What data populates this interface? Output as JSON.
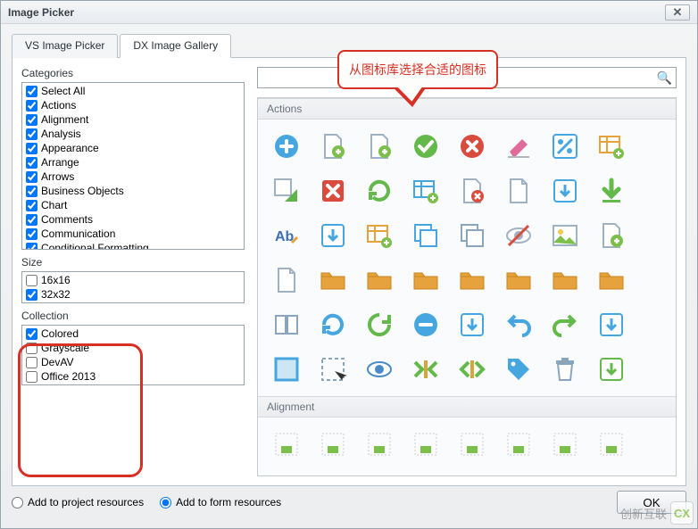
{
  "window": {
    "title": "Image Picker",
    "close_glyph": "✕"
  },
  "tabs": [
    {
      "id": "vs",
      "label": "VS Image Picker",
      "active": false
    },
    {
      "id": "dx",
      "label": "DX Image Gallery",
      "active": true
    }
  ],
  "callout": {
    "text": "从图标库选择合适的图标"
  },
  "categories": {
    "label": "Categories",
    "items": [
      {
        "label": "Select All",
        "checked": true
      },
      {
        "label": "Actions",
        "checked": true
      },
      {
        "label": "Alignment",
        "checked": true
      },
      {
        "label": "Analysis",
        "checked": true
      },
      {
        "label": "Appearance",
        "checked": true
      },
      {
        "label": "Arrange",
        "checked": true
      },
      {
        "label": "Arrows",
        "checked": true
      },
      {
        "label": "Business Objects",
        "checked": true
      },
      {
        "label": "Chart",
        "checked": true
      },
      {
        "label": "Comments",
        "checked": true
      },
      {
        "label": "Communication",
        "checked": true
      },
      {
        "label": "Conditional Formatting",
        "checked": true
      }
    ]
  },
  "size": {
    "label": "Size",
    "items": [
      {
        "label": "16x16",
        "checked": false
      },
      {
        "label": "32x32",
        "checked": true
      }
    ]
  },
  "collection": {
    "label": "Collection",
    "items": [
      {
        "label": "Colored",
        "checked": true
      },
      {
        "label": "Grayscale",
        "checked": false
      },
      {
        "label": "DevAV",
        "checked": false
      },
      {
        "label": "Office 2013",
        "checked": false
      }
    ]
  },
  "search": {
    "placeholder": ""
  },
  "sections": [
    {
      "title": "Actions",
      "icons": [
        {
          "name": "add-circle-icon",
          "c": "#46a7e0",
          "t": "plus-circle"
        },
        {
          "name": "add-page-icon",
          "c": "#7cc04b",
          "t": "page-plus"
        },
        {
          "name": "add-doc-icon",
          "c": "#7cc04b",
          "t": "doc-plus"
        },
        {
          "name": "apply-icon",
          "c": "#63b94a",
          "t": "check-circle"
        },
        {
          "name": "cancel-circle-icon",
          "c": "#d94b3d",
          "t": "x-circle"
        },
        {
          "name": "clear-icon",
          "c": "#e06a9a",
          "t": "eraser"
        },
        {
          "name": "percent-icon",
          "c": "#46a7e0",
          "t": "percent"
        },
        {
          "name": "table-add-icon",
          "c": "#e6a23c",
          "t": "table-plus"
        },
        {
          "name": "convert-icon",
          "c": "#60b24b",
          "t": "arrow-corner"
        },
        {
          "name": "close-box-icon",
          "c": "#d94b3d",
          "t": "x-box"
        },
        {
          "name": "refresh-green-icon",
          "c": "#63b94a",
          "t": "refresh"
        },
        {
          "name": "table-refresh-icon",
          "c": "#46a7e0",
          "t": "table-refresh"
        },
        {
          "name": "page-delete-icon",
          "c": "#d94b3d",
          "t": "page-x"
        },
        {
          "name": "page-icon",
          "c": "#8aa6bd",
          "t": "page"
        },
        {
          "name": "download-box-icon",
          "c": "#46a7e0",
          "t": "down-box"
        },
        {
          "name": "download-green-icon",
          "c": "#63b94a",
          "t": "down-arrow"
        },
        {
          "name": "spellcheck-icon",
          "c": "#3d6fb5",
          "t": "ab"
        },
        {
          "name": "down-box-icon",
          "c": "#46a7e0",
          "t": "down-square"
        },
        {
          "name": "table-edit-icon",
          "c": "#e6a23c",
          "t": "table-pen"
        },
        {
          "name": "copy-icon",
          "c": "#46a7e0",
          "t": "copy"
        },
        {
          "name": "duplicate-icon",
          "c": "#8aa6bd",
          "t": "dup"
        },
        {
          "name": "hide-icon",
          "c": "#d94b3d",
          "t": "eye-slash"
        },
        {
          "name": "picture-icon",
          "c": "#e6a23c",
          "t": "picture"
        },
        {
          "name": "page-add-icon",
          "c": "#7cc04b",
          "t": "page-plus2"
        },
        {
          "name": "new-doc-icon",
          "c": "#8aa6bd",
          "t": "new"
        },
        {
          "name": "folder-icon",
          "c": "#e6a23c",
          "t": "folder"
        },
        {
          "name": "folder-up-icon",
          "c": "#e6a23c",
          "t": "folder-up"
        },
        {
          "name": "folder-refresh-icon",
          "c": "#e6a23c",
          "t": "folder-refresh"
        },
        {
          "name": "folder-open-icon",
          "c": "#e6a23c",
          "t": "folder-open"
        },
        {
          "name": "folder-star-icon",
          "c": "#e6a23c",
          "t": "folder-star"
        },
        {
          "name": "folder-out-icon",
          "c": "#e6a23c",
          "t": "folder-out"
        },
        {
          "name": "folder-go-icon",
          "c": "#e6a23c",
          "t": "folder-go"
        },
        {
          "name": "book-icon",
          "c": "#8aa6bd",
          "t": "book"
        },
        {
          "name": "refresh-blue-icon",
          "c": "#46a7e0",
          "t": "refresh"
        },
        {
          "name": "reload-icon",
          "c": "#63b94a",
          "t": "reload"
        },
        {
          "name": "remove-circle-icon",
          "c": "#46a7e0",
          "t": "minus-circle"
        },
        {
          "name": "back-box-icon",
          "c": "#46a7e0",
          "t": "back-box"
        },
        {
          "name": "undo-icon",
          "c": "#46a7e0",
          "t": "undo"
        },
        {
          "name": "redo-icon",
          "c": "#63b94a",
          "t": "redo"
        },
        {
          "name": "export-icon",
          "c": "#46a7e0",
          "t": "export"
        },
        {
          "name": "select-all-icon",
          "c": "#46a7e0",
          "t": "select"
        },
        {
          "name": "select-dashed-icon",
          "c": "#8aa6bd",
          "t": "dashed"
        },
        {
          "name": "show-icon",
          "c": "#4b8ac9",
          "t": "eye"
        },
        {
          "name": "squeeze-icon",
          "c": "#63b94a",
          "t": "squeeze"
        },
        {
          "name": "stretch-icon",
          "c": "#63b94a",
          "t": "stretch"
        },
        {
          "name": "tag-icon",
          "c": "#46a7e0",
          "t": "tag"
        },
        {
          "name": "trash-icon",
          "c": "#8aa6bd",
          "t": "trash"
        },
        {
          "name": "upload-icon",
          "c": "#63b94a",
          "t": "up-box"
        }
      ]
    },
    {
      "title": "Alignment",
      "icons": [
        {
          "name": "align-bottom-center-icon",
          "c": "#7cc04b",
          "t": "al"
        },
        {
          "name": "align-bottom-left-icon",
          "c": "#7cc04b",
          "t": "al"
        },
        {
          "name": "align-bottom-right-icon",
          "c": "#7cc04b",
          "t": "al"
        },
        {
          "name": "align-mid-center-icon",
          "c": "#7cc04b",
          "t": "al"
        },
        {
          "name": "align-mid-left-icon",
          "c": "#7cc04b",
          "t": "al"
        },
        {
          "name": "align-mid-right-icon",
          "c": "#7cc04b",
          "t": "al"
        },
        {
          "name": "align-top-center-icon",
          "c": "#7cc04b",
          "t": "al"
        },
        {
          "name": "align-top-left-icon",
          "c": "#7cc04b",
          "t": "al"
        }
      ]
    }
  ],
  "footer": {
    "radios": [
      {
        "label": "Add to project resources",
        "checked": false
      },
      {
        "label": "Add to form resources",
        "checked": true
      }
    ],
    "ok_label": "OK"
  },
  "watermark": {
    "brand": "创新互联",
    "logo": "CX"
  }
}
